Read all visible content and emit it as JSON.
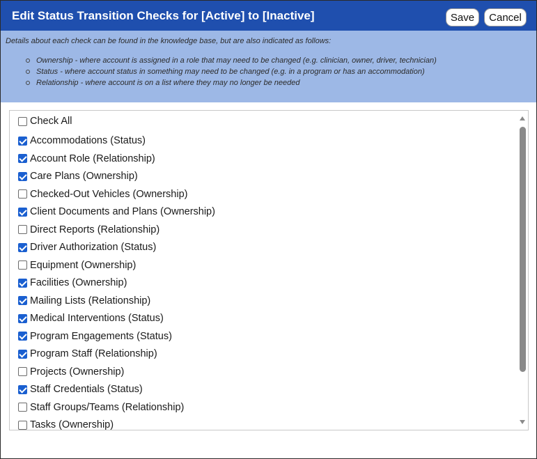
{
  "dialog": {
    "title": "Edit Status Transition Checks for [Active] to [Inactive]",
    "save_label": "Save",
    "cancel_label": "Cancel"
  },
  "info": {
    "intro": "Details about each check can be found in the knowledge base, but are also indicated as follows:",
    "bullets": [
      "Ownership - where account is assigned in a role that may need to be changed (e.g. clinician, owner, driver, technician)",
      "Status - where account status in something may need to be changed (e.g. in a program or has an accommodation)",
      "Relationship - where account is on a list where they may no longer be needed"
    ]
  },
  "checks": {
    "check_all": {
      "label": "Check All",
      "checked": false
    },
    "items": [
      {
        "label": "Accommodations (Status)",
        "checked": true
      },
      {
        "label": "Account Role (Relationship)",
        "checked": true
      },
      {
        "label": "Care Plans (Ownership)",
        "checked": true
      },
      {
        "label": "Checked-Out Vehicles (Ownership)",
        "checked": false
      },
      {
        "label": "Client Documents and Plans (Ownership)",
        "checked": true
      },
      {
        "label": "Direct Reports (Relationship)",
        "checked": false
      },
      {
        "label": "Driver Authorization (Status)",
        "checked": true
      },
      {
        "label": "Equipment (Ownership)",
        "checked": false
      },
      {
        "label": "Facilities (Ownership)",
        "checked": true
      },
      {
        "label": "Mailing Lists (Relationship)",
        "checked": true
      },
      {
        "label": "Medical Interventions (Status)",
        "checked": true
      },
      {
        "label": "Program Engagements (Status)",
        "checked": true
      },
      {
        "label": "Program Staff (Relationship)",
        "checked": true
      },
      {
        "label": "Projects (Ownership)",
        "checked": false
      },
      {
        "label": "Staff Credentials (Status)",
        "checked": true
      },
      {
        "label": "Staff Groups/Teams (Relationship)",
        "checked": false
      },
      {
        "label": "Tasks (Ownership)",
        "checked": false
      }
    ]
  },
  "colors": {
    "titlebar": "#1f4fae",
    "info_panel": "#9db8e6",
    "checkbox_checked": "#1a5fd0"
  }
}
